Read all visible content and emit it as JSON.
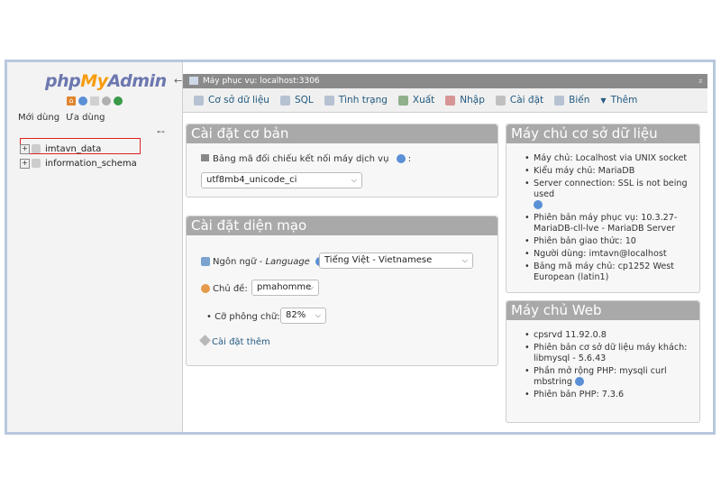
{
  "logo": {
    "php": "php",
    "my": "My",
    "admin": "Admin"
  },
  "nav": {
    "recent": "Mới dùng",
    "favorites": "Ưa dùng"
  },
  "databases": [
    "imtavn_data",
    "information_schema"
  ],
  "breadcrumb": {
    "server": "Máy phục vụ: localhost:3306"
  },
  "tabs": [
    "Cơ sở dữ liệu",
    "SQL",
    "Tình trạng",
    "Xuất",
    "Nhập",
    "Cài đặt",
    "Biến",
    "Thêm"
  ],
  "general_settings": {
    "title": "Cài đặt cơ bản",
    "collation_label": "Bảng mã đối chiếu kết nối máy dịch vụ",
    "collation_value": "utf8mb4_unicode_ci"
  },
  "appearance": {
    "title": "Cài đặt diện mạo",
    "language_label": "Ngôn ngữ",
    "language_en": "Language",
    "language_value": "Tiếng Việt - Vietnamese",
    "theme_label": "Chủ đề:",
    "theme_value": "pmahomme",
    "fontsize_label": "Cỡ phông chữ:",
    "fontsize_value": "82%",
    "more_settings": "Cài đặt thêm"
  },
  "db_server": {
    "title": "Máy chủ cơ sở dữ liệu",
    "items": [
      "Máy chủ: Localhost via UNIX socket",
      "Kiểu máy chủ: MariaDB",
      "Server connection: SSL is not being used",
      "Phiên bản máy phục vụ: 10.3.27-MariaDB-cll-lve - MariaDB Server",
      "Phiên bản giao thức: 10",
      "Người dùng: imtavn@localhost",
      "Bảng mã máy chủ: cp1252 West European (latin1)"
    ]
  },
  "web_server": {
    "title": "Máy chủ Web",
    "items": [
      "cpsrvd 11.92.0.8",
      "Phiên bản cơ sở dữ liệu máy khách: libmysql - 5.6.43",
      "Phần mở rộng PHP: mysqli curl mbstring",
      "Phiên bản PHP: 7.3.6"
    ]
  },
  "colors": {
    "accent": "#235a81",
    "panel_header": "#a9a9a9",
    "highlight": "#dd2222"
  }
}
